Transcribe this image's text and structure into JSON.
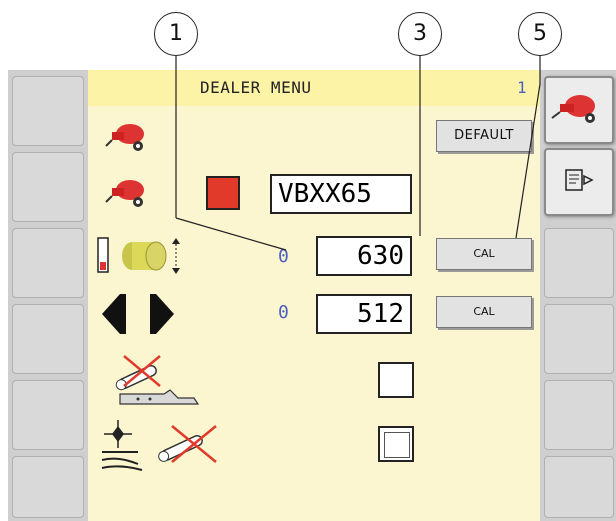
{
  "callouts": [
    "1",
    "3",
    "5"
  ],
  "header": {
    "title": "DEALER MENU",
    "page_number": "1"
  },
  "rows": {
    "default_button": "DEFAULT",
    "model_value": "VBXX65",
    "bale_diameter": {
      "zero": "0",
      "value": "630",
      "button": "CAL"
    },
    "density": {
      "zero": "0",
      "value": "512",
      "button": "CAL"
    }
  },
  "icons": {
    "baler_small": "baler-icon",
    "bale_roll": "bale-diameter-icon",
    "density": "density-arrows-icon",
    "knife": "knife-disabled-icon",
    "net": "net-disabled-icon"
  },
  "colors": {
    "panel": "#fbf6cf",
    "titlebar": "#fdf3a6",
    "accent": "#4a5fc0",
    "red_box": "#e23a2a"
  }
}
